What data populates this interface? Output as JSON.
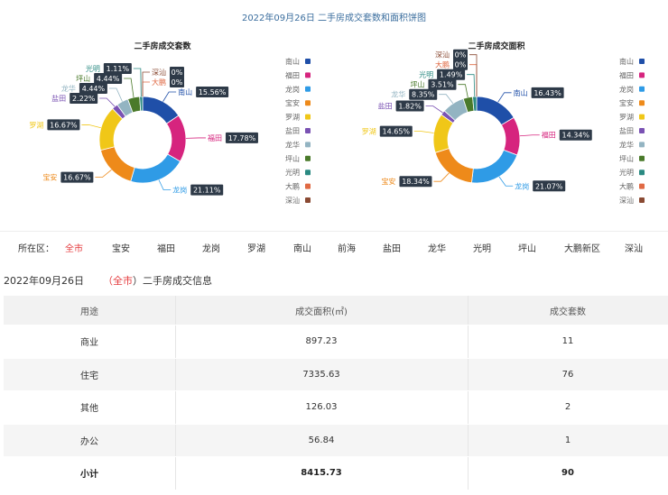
{
  "top_title": "2022年09月26日 二手房成交套数和面积饼图",
  "legend_colors": [
    "#1f4fa8",
    "#d6247e",
    "#2f9be6",
    "#ee8a1a",
    "#f0c718",
    "#7a52b3",
    "#93b4c2",
    "#4a7a2a",
    "#2a8a82",
    "#e06a44",
    "#8a4a33"
  ],
  "chart_data": [
    {
      "type": "pie",
      "title": "二手房成交套数",
      "legend_position": "right",
      "slices": [
        {
          "name": "南山",
          "value": 15.56,
          "label": "15.56%"
        },
        {
          "name": "福田",
          "value": 17.78,
          "label": "17.78%"
        },
        {
          "name": "龙岗",
          "value": 21.11,
          "label": "21.11%"
        },
        {
          "name": "宝安",
          "value": 16.67,
          "label": "16.67%"
        },
        {
          "name": "罗湖",
          "value": 16.67,
          "label": "16.67%"
        },
        {
          "name": "盐田",
          "value": 2.22,
          "label": "2.22%"
        },
        {
          "name": "龙华",
          "value": 4.44,
          "label": "4.44%"
        },
        {
          "name": "坪山",
          "value": 4.44,
          "label": "4.44%"
        },
        {
          "name": "光明",
          "value": 1.11,
          "label": "1.11%"
        },
        {
          "name": "大鹏",
          "value": 0,
          "label": "0%"
        },
        {
          "name": "深汕",
          "value": 0,
          "label": "0%"
        }
      ]
    },
    {
      "type": "pie",
      "title": "二手房成交面积",
      "legend_position": "right",
      "slices": [
        {
          "name": "南山",
          "value": 16.43,
          "label": "16.43%"
        },
        {
          "name": "福田",
          "value": 14.34,
          "label": "14.34%"
        },
        {
          "name": "龙岗",
          "value": 21.07,
          "label": "21.07%"
        },
        {
          "name": "宝安",
          "value": 18.34,
          "label": "18.34%"
        },
        {
          "name": "罗湖",
          "value": 14.65,
          "label": "14.65%"
        },
        {
          "name": "盐田",
          "value": 1.82,
          "label": "1.82%"
        },
        {
          "name": "龙华",
          "value": 8.35,
          "label": "8.35%"
        },
        {
          "name": "坪山",
          "value": 3.51,
          "label": "3.51%"
        },
        {
          "name": "光明",
          "value": 1.49,
          "label": "1.49%"
        },
        {
          "name": "大鹏",
          "value": 0,
          "label": "0%"
        },
        {
          "name": "深汕",
          "value": 0,
          "label": "0%"
        }
      ]
    }
  ],
  "filter": {
    "label": "所在区：",
    "districts": [
      "全市",
      "宝安",
      "福田",
      "龙岗",
      "罗湖",
      "南山",
      "前海",
      "盐田",
      "龙华",
      "光明",
      "坪山",
      "大鹏新区",
      "深汕"
    ],
    "active_index": 0
  },
  "info": {
    "date": "2022年09月26日",
    "open": "（",
    "scope": "全市",
    "close": "）二手房成交信息"
  },
  "table": {
    "headers": [
      "用途",
      "成交面积(㎡)",
      "成交套数"
    ],
    "rows": [
      [
        "商业",
        "897.23",
        "11"
      ],
      [
        "住宅",
        "7335.63",
        "76"
      ],
      [
        "其他",
        "126.03",
        "2"
      ],
      [
        "办公",
        "56.84",
        "1"
      ]
    ],
    "total": [
      "小计",
      "8415.73",
      "90"
    ]
  }
}
